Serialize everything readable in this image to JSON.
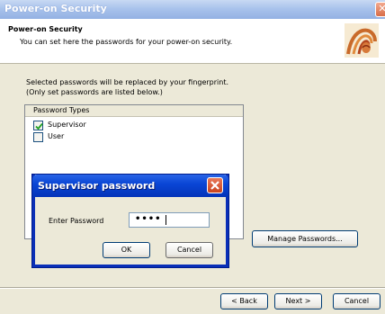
{
  "window": {
    "title": "Power-on Security",
    "close_symbol": "✕"
  },
  "header": {
    "title": "Power-on Security",
    "subtitle": "You can set here the passwords for your power-on security.",
    "icon": "fingerprint-icon"
  },
  "info": {
    "line1": "Selected passwords will be replaced by your fingerprint.",
    "line2": "(Only set passwords are listed below.)"
  },
  "password_types": {
    "header": "Password Types",
    "items": [
      {
        "label": "Supervisor",
        "checked": true
      },
      {
        "label": "User",
        "checked": false
      }
    ]
  },
  "manage_button": "Manage Passwords...",
  "wizard_buttons": {
    "back": "< Back",
    "next": "Next >",
    "cancel": "Cancel"
  },
  "dialog": {
    "title": "Supervisor password",
    "field_label": "Enter Password",
    "field_value": "••••",
    "ok": "OK",
    "cancel": "Cancel"
  },
  "colors": {
    "dialog_title_bar": "#0a46d6",
    "wizard_title_bar": "#a9c3ec",
    "close_button": "#d4532c"
  }
}
